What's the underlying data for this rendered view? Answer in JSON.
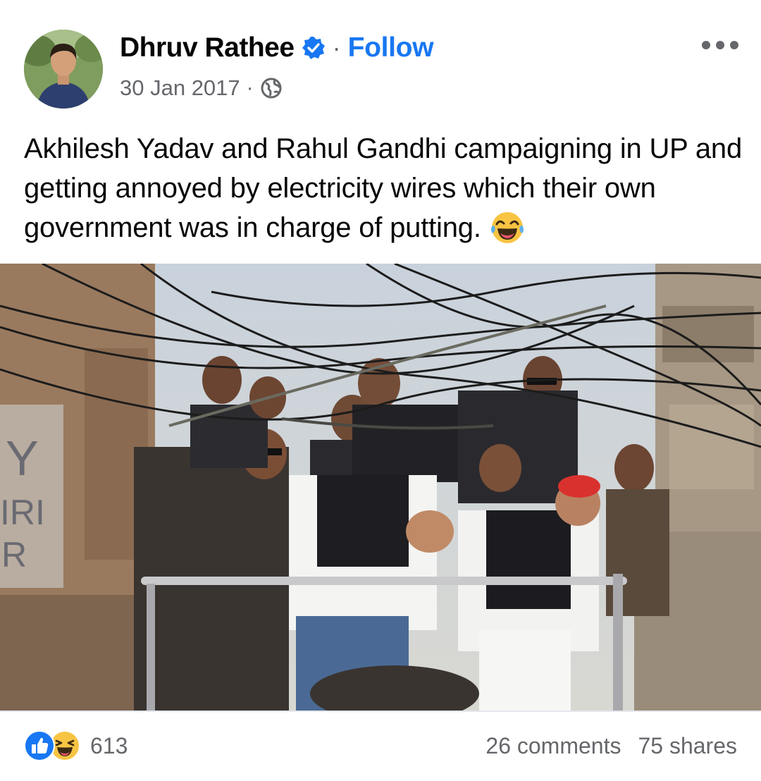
{
  "post": {
    "author": "Dhruv Rathee",
    "follow_label": "Follow",
    "separator": "·",
    "date": "30 Jan 2017",
    "audience_icon": "globe-icon",
    "verified_icon": "verified-badge-icon",
    "text": "Akhilesh Yadav and Rahul Gandhi campaigning in UP and getting annoyed by electricity wires which their own government was in charge of putting.",
    "text_emoji": "laughing-crying-emoji"
  },
  "footer": {
    "reaction_icons": [
      "like-icon",
      "haha-icon"
    ],
    "reaction_count": "613",
    "comments": "26 comments",
    "shares": "75 shares"
  },
  "colors": {
    "accent": "#1877f2",
    "secondary_text": "#65676b",
    "primary_text": "#050505",
    "divider": "#e4e6eb"
  }
}
